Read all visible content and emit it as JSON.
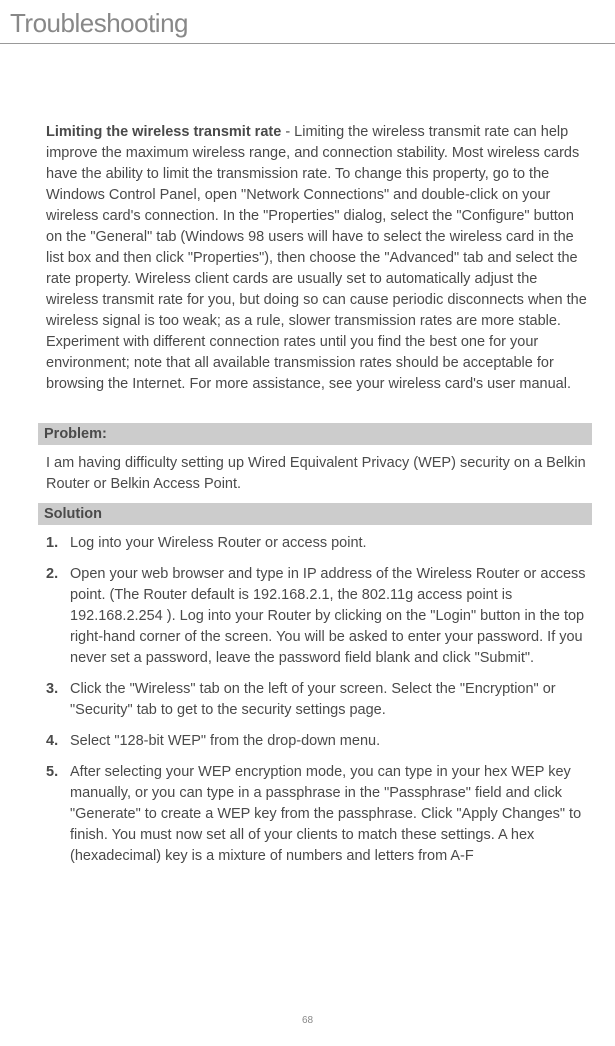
{
  "title": "Troubleshooting",
  "intro": {
    "bold": "Limiting the wireless transmit rate",
    "rest": " - Limiting the wireless transmit rate can help improve the maximum wireless range, and connection stability. Most wireless cards have the ability to limit the transmission rate. To change this property, go to the Windows Control Panel, open \"Network Connections\" and double-click on your wireless card's connection. In the \"Properties\" dialog, select the \"Configure\" button on the \"General\" tab (Windows 98 users will have to select the wireless card in the list box and then click \"Properties\"), then choose the \"Advanced\" tab and select the rate property. Wireless client cards are usually set to automatically adjust the wireless transmit rate for you, but doing so can cause periodic disconnects when the wireless signal is too weak; as a rule, slower transmission rates are more stable. Experiment with different connection rates until you find the best one for your environment; note that all available transmission rates should be acceptable for browsing the Internet. For more assistance, see your wireless card's user manual."
  },
  "problem": {
    "header": "Problem:",
    "text": "I am having difficulty setting up Wired Equivalent Privacy (WEP) security on a Belkin Router or Belkin Access Point."
  },
  "solution": {
    "header": "Solution",
    "steps": [
      {
        "num": "1.",
        "text": "Log into your Wireless Router or access point."
      },
      {
        "num": "2.",
        "text": "Open your web browser and type in IP address of the Wireless Router or access point. (The Router default is 192.168.2.1, the 802.11g access point is 192.168.2.254 ). Log into your Router by clicking on the \"Login\" button in the top right-hand corner of the screen. You will be asked to enter your password. If you never set a password, leave the password field blank and click \"Submit\"."
      },
      {
        "num": "3.",
        "text": "Click the \"Wireless\" tab on the left of your screen. Select the \"Encryption\" or \"Security\" tab to get to the security settings page."
      },
      {
        "num": "4.",
        "text": "Select \"128-bit WEP\" from the drop-down menu."
      },
      {
        "num": "5.",
        "text": "After selecting your WEP encryption mode, you can type in your hex WEP key manually, or you can type in a passphrase in the \"Passphrase\" field and click \"Generate\" to create a WEP key from the passphrase. Click \"Apply Changes\" to finish. You must now set all of your clients to match these settings. A hex (hexadecimal) key is a mixture of numbers and letters from A-F"
      }
    ]
  },
  "page_num": "68"
}
